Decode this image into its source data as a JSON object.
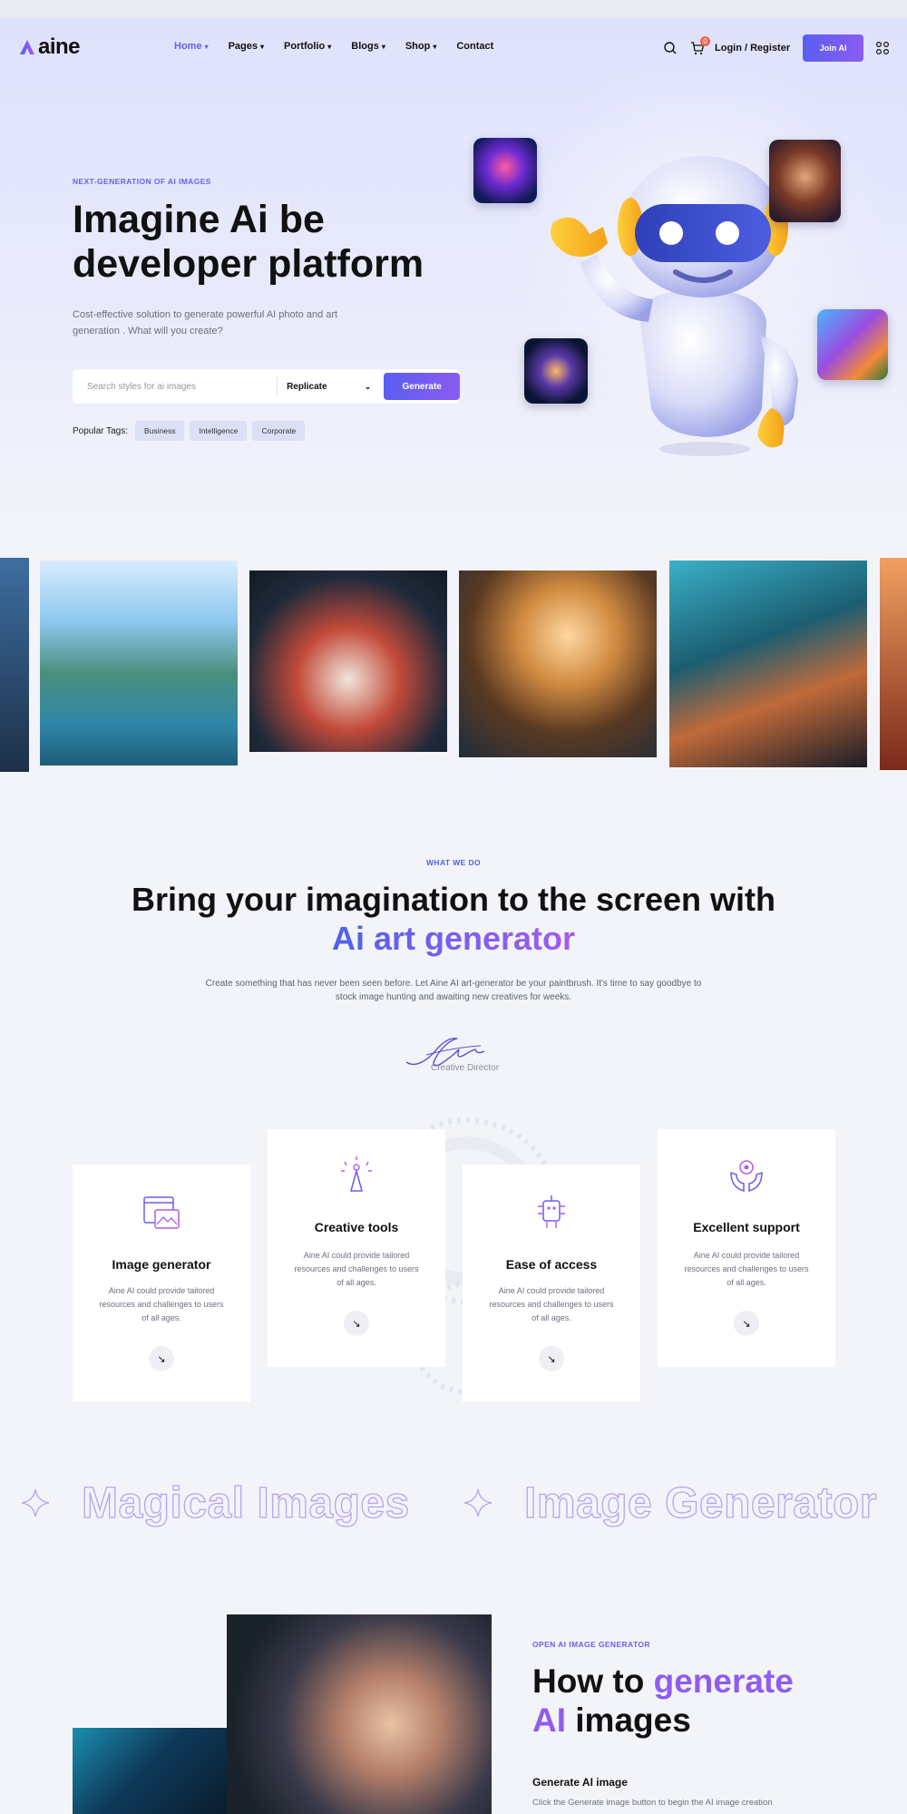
{
  "brand": {
    "name": "aine",
    "accent": "#6b5cf2",
    "gradient_start": "#5b5ef0",
    "gradient_end": "#8a5cf0"
  },
  "nav": {
    "items": [
      {
        "label": "Home",
        "dropdown": true,
        "active": true
      },
      {
        "label": "Pages",
        "dropdown": true,
        "active": false
      },
      {
        "label": "Portfolio",
        "dropdown": true,
        "active": false
      },
      {
        "label": "Blogs",
        "dropdown": true,
        "active": false
      },
      {
        "label": "Shop",
        "dropdown": true,
        "active": false
      },
      {
        "label": "Contact",
        "dropdown": false,
        "active": false
      }
    ],
    "cart_count": "0",
    "login_label": "Login / Register",
    "join_label": "Join AI",
    "icons": [
      "search-icon",
      "cart-icon",
      "apps-grid-icon"
    ]
  },
  "hero": {
    "eyebrow": "NEXT-GENERATION OF AI IMAGES",
    "title": "Imagine Ai be developer platform",
    "subtitle": "Cost-effective solution to generate powerful AI photo and art generation . What will you create?",
    "search_placeholder": "Search styles for ai images",
    "select_value": "Replicate",
    "generate_label": "Generate",
    "popular_label": "Popular Tags:",
    "tags": [
      "Business",
      "Intelligence",
      "Corporate"
    ]
  },
  "what_we_do": {
    "eyebrow": "WHAT WE DO",
    "title_plain": "Bring your imagination to the screen with",
    "title_accent": "Ai art generator",
    "subtitle": "Create something that has never been seen before. Let Aine AI art-generator be your paintbrush. It's time to say goodbye to stock image hunting and awaiting new creatives for weeks.",
    "signature_role": "Creative Director",
    "cards": [
      {
        "title": "Image generator",
        "text": "Aine AI could provide tailored resources and challenges to users of all ages.",
        "icon": "image-generator-icon"
      },
      {
        "title": "Creative tools",
        "text": "Aine AI could provide tailored resources and challenges to users of all ages.",
        "icon": "creative-tools-icon"
      },
      {
        "title": "Ease of access",
        "text": "Aine AI could provide tailored resources and challenges to users of all ages.",
        "icon": "ease-of-access-icon"
      },
      {
        "title": "Excellent support",
        "text": "Aine AI could provide tailored resources and challenges to users of all ages.",
        "icon": "support-icon"
      }
    ]
  },
  "marquee": {
    "items": [
      "Magical Images",
      "Image Generator"
    ]
  },
  "howto": {
    "eyebrow": "OPEN AI IMAGE GENERATOR",
    "title_part1": "How to",
    "title_accent1": "generate",
    "title_accent2": "AI",
    "title_part2": "images",
    "step_title": "Generate AI image",
    "step_text": "Click the Generate image button to begin the AI image creation"
  }
}
